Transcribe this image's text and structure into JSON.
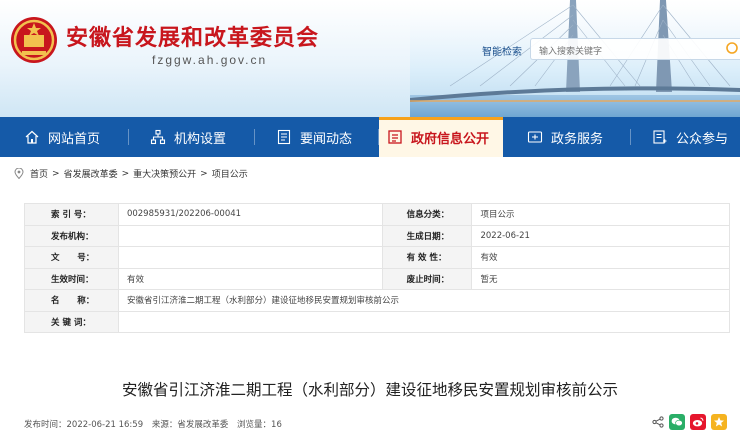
{
  "header": {
    "site_title": "安徽省发展和改革委员会",
    "site_domain": "fzggw.ah.gov.cn",
    "search_label": "智能检索",
    "search_placeholder": "输入搜索关键字"
  },
  "nav": {
    "items": [
      {
        "label": "网站首页",
        "icon": "home-icon"
      },
      {
        "label": "机构设置",
        "icon": "org-chart-icon"
      },
      {
        "label": "要闻动态",
        "icon": "document-icon"
      },
      {
        "label": "政府信息公开",
        "icon": "info-list-icon",
        "active": true
      },
      {
        "label": "政务服务",
        "icon": "service-icon"
      },
      {
        "label": "公众参与",
        "icon": "participation-icon"
      }
    ]
  },
  "breadcrumb": {
    "items": [
      "首页",
      "省发展改革委",
      "重大决策预公开",
      "项目公示"
    ],
    "separator": ">"
  },
  "info": {
    "index_label": "索 引 号：",
    "index_value": "002985931/202206-00041",
    "category_label": "信息分类：",
    "category_value": "项目公示",
    "publisher_label": "发布机构：",
    "publisher_value": "",
    "created_label": "生成日期：",
    "created_value": "2022-06-21",
    "docno_label": "文      号：",
    "docno_value": "",
    "validity_label": "有 效 性：",
    "validity_value": "有效",
    "effective_label": "生效时间：",
    "effective_value": "有效",
    "repeal_label": "废止时间：",
    "repeal_value": "暂无",
    "name_label": "名      称：",
    "name_value": "安徽省引江济淮二期工程（水利部分）建设征地移民安置规划审核前公示",
    "keywords_label": "关 键 词：",
    "keywords_value": ""
  },
  "article": {
    "title": "安徽省引江济淮二期工程（水利部分）建设征地移民安置规划审核前公示",
    "publish_time": "发布时间：2022-06-21 16:59",
    "source": "来源：省发展改革委",
    "views": "浏览量：16"
  },
  "colors": {
    "brand_red": "#c8161d",
    "nav_blue": "#155aa8",
    "active_accent": "#f7a21b",
    "wechat_green": "#2aae67",
    "weibo_red": "#e6162d",
    "qzone_yellow": "#f5b320"
  }
}
